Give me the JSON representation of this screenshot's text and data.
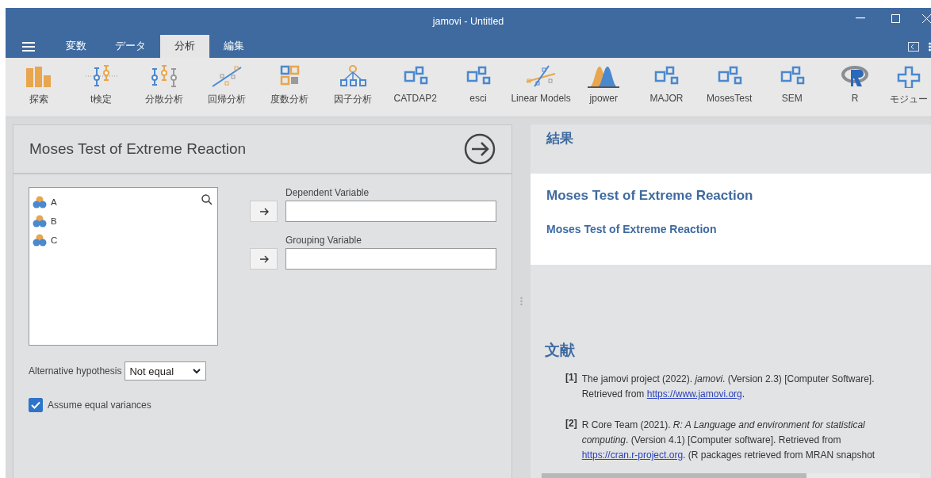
{
  "window": {
    "title": "jamovi - Untitled"
  },
  "menu_tabs": [
    {
      "label": "変数",
      "selected": false
    },
    {
      "label": "データ",
      "selected": false
    },
    {
      "label": "分析",
      "selected": true
    },
    {
      "label": "編集",
      "selected": false
    }
  ],
  "toolbar": [
    {
      "label": "探索",
      "kind": "bars"
    },
    {
      "label": "t検定",
      "kind": "ttest"
    },
    {
      "label": "分散分析",
      "kind": "anova"
    },
    {
      "label": "回帰分析",
      "kind": "regression"
    },
    {
      "label": "度数分析",
      "kind": "frequency"
    },
    {
      "label": "因子分析",
      "kind": "factor"
    },
    {
      "label": "CATDAP2",
      "kind": "module"
    },
    {
      "label": "esci",
      "kind": "module"
    },
    {
      "label": "Linear Models",
      "kind": "linear"
    },
    {
      "label": "jpower",
      "kind": "power"
    },
    {
      "label": "MAJOR",
      "kind": "module"
    },
    {
      "label": "MosesTest",
      "kind": "module"
    },
    {
      "label": "SEM",
      "kind": "module"
    },
    {
      "label": "R",
      "kind": "r"
    },
    {
      "label": "モジュー",
      "kind": "plus"
    }
  ],
  "analysis": {
    "title": "Moses Test of Extreme Reaction",
    "variables": [
      {
        "name": "A"
      },
      {
        "name": "B"
      },
      {
        "name": "C"
      }
    ],
    "targets": [
      {
        "label": "Dependent Variable"
      },
      {
        "label": "Grouping Variable"
      }
    ],
    "alternative": {
      "label": "Alternative hypothesis",
      "value": "Not equal"
    },
    "equal_variances": {
      "label": "Assume equal variances",
      "checked": true
    }
  },
  "results": {
    "heading": "結果",
    "title": "Moses Test of Extreme Reaction",
    "subtitle": "Moses Test of Extreme Reaction",
    "references_heading": "文献",
    "references": [
      {
        "number": "[1]",
        "text": "The jamovi project (2022). *jamovi*. (Version 2.3) [Computer Software]. Retrieved from ",
        "link": "https://www.jamovi.org",
        "after": "."
      },
      {
        "number": "[2]",
        "text": "R Core Team (2021). *R: A Language and environment for statistical computing*. (Version 4.1) [Computer software]. Retrieved from ",
        "link": "https://cran.r-project.org",
        "after": ". (R packages retrieved from MRAN snapshot"
      }
    ]
  }
}
